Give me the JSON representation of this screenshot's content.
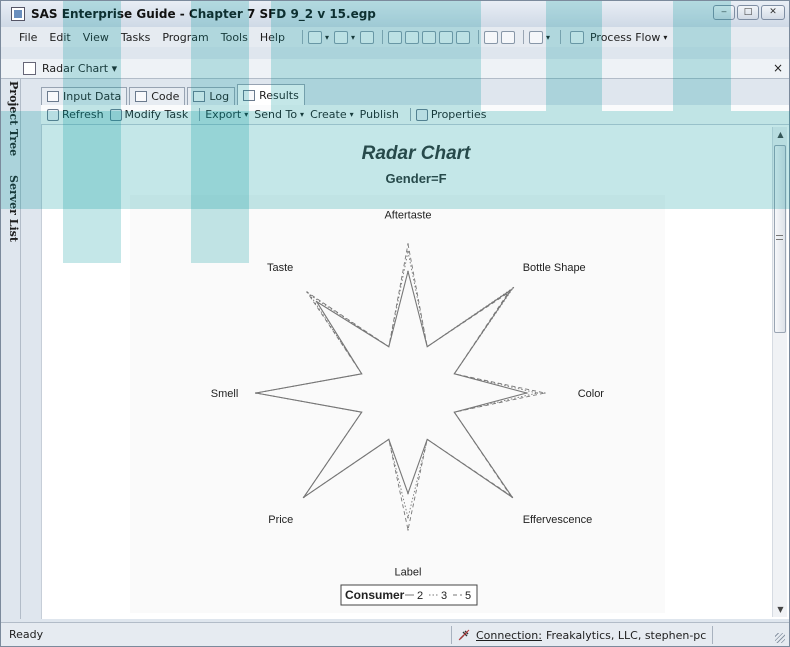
{
  "window": {
    "title": "SAS Enterprise Guide - Chapter 7 SFD 9_2 v 15.egp",
    "buttons": {
      "minimize": "‒",
      "maximize": "□",
      "close": "✕"
    }
  },
  "menu": {
    "items": [
      "File",
      "Edit",
      "View",
      "Tasks",
      "Program",
      "Tools",
      "Help"
    ],
    "process_flow_label": "Process Flow"
  },
  "document": {
    "tab_label": "Radar Chart ▾",
    "close_glyph": "×"
  },
  "side_rail": {
    "project_tree": "Project Tree",
    "server_list": "Server List"
  },
  "subtabs": [
    {
      "label": "Input Data",
      "icon": "table-icon"
    },
    {
      "label": "Code",
      "icon": "code-icon"
    },
    {
      "label": "Log",
      "icon": "log-icon"
    },
    {
      "label": "Results",
      "icon": "results-icon",
      "active": true
    }
  ],
  "actions": {
    "refresh": "Refresh",
    "modify_task": "Modify Task",
    "export": "Export",
    "send_to": "Send To",
    "create": "Create",
    "publish": "Publish",
    "properties": "Properties"
  },
  "chart_data": {
    "type": "radar",
    "title": "Radar Chart",
    "subtitle": "Gender=F",
    "categories": [
      "Aftertaste",
      "Bottle Shape",
      "Color",
      "Effervescence",
      "Label",
      "Price",
      "Smell",
      "Taste"
    ],
    "rmax": 1,
    "series": [
      {
        "name": "2",
        "style": "solid",
        "values": [
          0.8,
          0.96,
          0.78,
          0.97,
          0.66,
          0.97,
          1.0,
          0.85
        ]
      },
      {
        "name": "3",
        "style": "dotted",
        "values": [
          0.93,
          0.98,
          0.85,
          0.97,
          0.82,
          0.97,
          1.0,
          0.91
        ]
      },
      {
        "name": "5",
        "style": "dashed",
        "values": [
          0.98,
          0.93,
          0.9,
          0.95,
          0.9,
          0.97,
          1.0,
          0.94
        ]
      }
    ],
    "legend": {
      "title": "Consumer",
      "position": "bottom-center"
    },
    "line_color": "#777777"
  },
  "status": {
    "ready": "Ready",
    "connection_label": "Connection:",
    "connection_value": "Freakalytics, LLC, stephen-pc"
  }
}
